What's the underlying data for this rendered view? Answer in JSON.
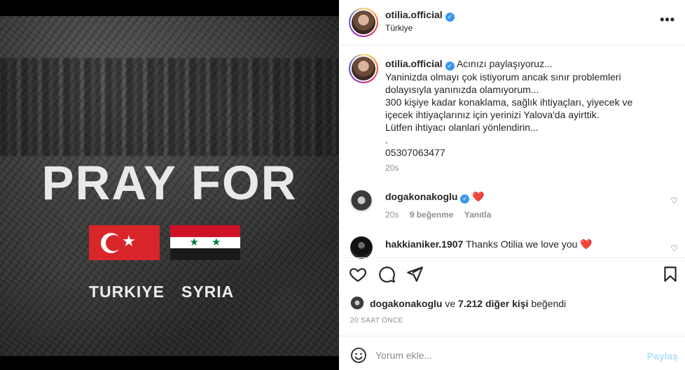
{
  "post": {
    "banner_text": "PRAY FOR",
    "flag_labels": [
      "TURKIYE",
      "SYRIA"
    ]
  },
  "header": {
    "username": "otilia.official",
    "location": "Türkiye",
    "more_icon": "more-horizontal-icon"
  },
  "caption": {
    "username": "otilia.official",
    "lines": [
      "Acınızı paylaşıyoruz...",
      "Yaninizda olmayı çok istiyorum ancak sınır problemleri",
      "dolayısıyla yanınızda olamıyorum...",
      "300 kişiye kadar konaklama, sağlık ihtiyaçları, yiyecek ve",
      "içecek ihtiyaçlarınız için yerinizi Yalova'da ayirttik.",
      "Lütfen ihtiyacı olanlari yönlendirin...",
      ".",
      "05307063477"
    ],
    "time": "20s"
  },
  "comments": [
    {
      "username": "dogakonakoglu",
      "text": "❤️",
      "time": "20s",
      "likes": "9 beğenme",
      "reply": "Yanıtla"
    },
    {
      "username": "hakkianiker.1907",
      "text": "Thanks Otilia we love you ❤️"
    }
  ],
  "actions": {
    "icons": [
      "heart-icon",
      "comment-icon",
      "share-icon",
      "bookmark-icon"
    ]
  },
  "likes": {
    "user": "dogakonakoglu",
    "connector": "ve",
    "others": "7.212 diğer kişi",
    "suffix": "beğendi"
  },
  "age": "20 SAAT ÖNCE",
  "comment_box": {
    "placeholder": "Yorum ekle...",
    "post_label": "Paylaş"
  },
  "colors": {
    "verified": "#3897f0",
    "heart": "#ed4956",
    "muted": "#8e8e8e",
    "post_button": "#b2dffc"
  }
}
